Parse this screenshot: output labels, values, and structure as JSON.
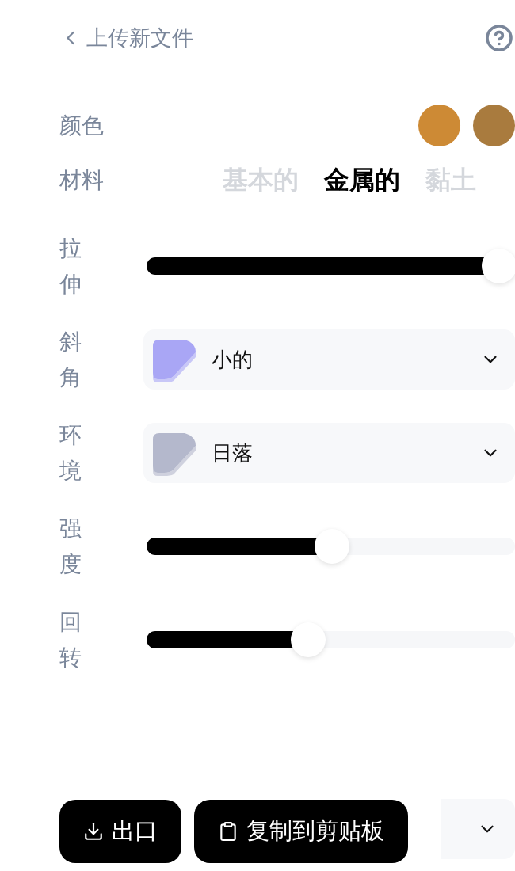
{
  "header": {
    "back_label": "上传新文件"
  },
  "color": {
    "label": "颜色",
    "swatches": [
      {
        "color": "#cd8a35"
      },
      {
        "color": "#a97b3e"
      }
    ]
  },
  "material": {
    "label": "材料",
    "options": [
      {
        "label": "基本的",
        "selected": false
      },
      {
        "label": "金属的",
        "selected": true
      },
      {
        "label": "黏土",
        "selected": false
      }
    ]
  },
  "controls": [
    {
      "kind": "slider",
      "label": "拉伸",
      "level": 1
    },
    {
      "kind": "dropdown",
      "label": "斜角",
      "value": "小的",
      "color": "#a9a6f5"
    },
    {
      "kind": "dropdown",
      "label": "环境",
      "value": "日落",
      "color": "#b4b8cc"
    },
    {
      "kind": "slider",
      "label": "强度",
      "level": 0.5
    },
    {
      "kind": "slider",
      "label": "回转",
      "level": 0.43
    }
  ],
  "bottom_dropdown": {
    "kind": "dropdown"
  },
  "actions": [
    {
      "kind": "download",
      "label": "出口"
    },
    {
      "kind": "clipboard",
      "label": "复制到剪贴板"
    }
  ]
}
